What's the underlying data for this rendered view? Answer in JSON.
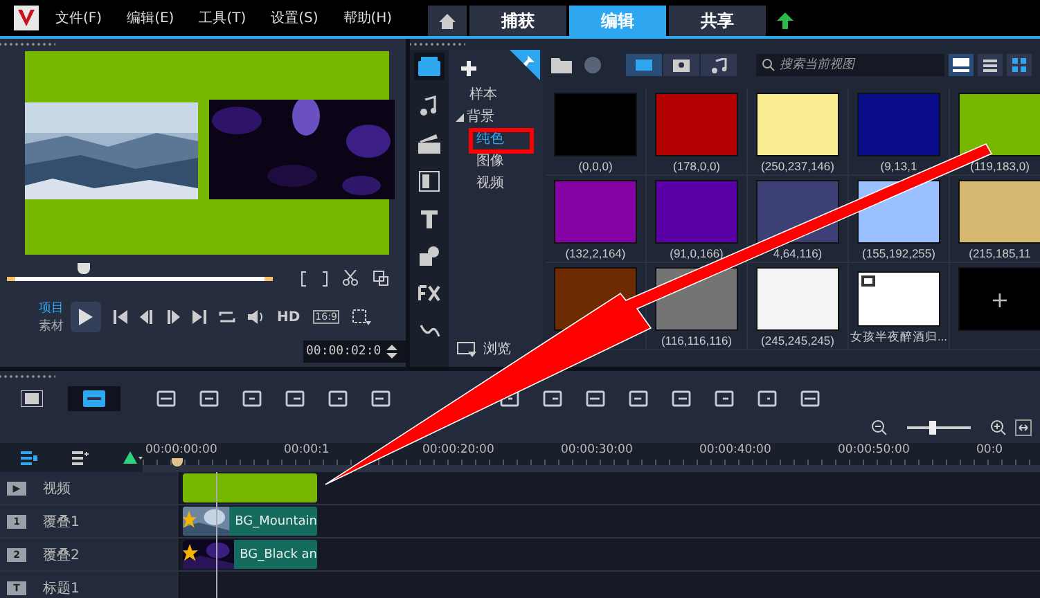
{
  "menu": [
    "文件(F)",
    "编辑(E)",
    "工具(T)",
    "设置(S)",
    "帮助(H)"
  ],
  "tabs": [
    {
      "label": "捕获",
      "selected": false
    },
    {
      "label": "编辑",
      "selected": true
    },
    {
      "label": "共享",
      "selected": false
    }
  ],
  "preview": {
    "mode_project": "项目",
    "mode_clip": "素材",
    "hd": "HD",
    "aspect": "16:9",
    "timecode": "00:00:02:0",
    "scrub": {
      "level": 0.27
    }
  },
  "library": {
    "tree": [
      {
        "label": "样本",
        "selected": false
      },
      {
        "label": "背景",
        "expanded": true,
        "children": [
          {
            "label": "纯色",
            "selected": true
          },
          {
            "label": "图像",
            "selected": false
          },
          {
            "label": "视频",
            "selected": false
          }
        ]
      }
    ],
    "browse": "浏览",
    "search": {
      "placeholder": "搜索当前视图"
    },
    "tiles": [
      {
        "kind": "color",
        "color": "#000000",
        "label": "(0,0,0)"
      },
      {
        "kind": "color",
        "color": "#b20000",
        "label": "(178,0,0)"
      },
      {
        "kind": "color",
        "color": "#faed92",
        "label": "(250,237,146)"
      },
      {
        "kind": "color",
        "color": "#090d8a",
        "label": "(9,13,1"
      },
      {
        "kind": "color",
        "color": "#77b700",
        "label": "(119,183,0)"
      },
      {
        "kind": "color",
        "color": "#8402a4",
        "label": "(132,2,164)"
      },
      {
        "kind": "color",
        "color": "#5b00a6",
        "label": "(91,0,166)"
      },
      {
        "kind": "color",
        "color": "#3c4074",
        "label": "4,64,116)"
      },
      {
        "kind": "color",
        "color": "#9bc0ff",
        "label": "(155,192,255)"
      },
      {
        "kind": "color",
        "color": "#d7b973",
        "label": "(215,185,11"
      },
      {
        "kind": "color",
        "color": "#6e2a00"
      },
      {
        "kind": "color",
        "color": "#747474",
        "label": "(116,116,116)"
      },
      {
        "kind": "color",
        "color": "#f5f5f5",
        "label": "(245,245,245)"
      },
      {
        "kind": "video",
        "color": "#ffffff",
        "label": "女孩半夜醉酒归..."
      },
      {
        "kind": "add",
        "color": "#000000",
        "label": "+"
      }
    ]
  },
  "timeline": {
    "zoom": {
      "level": 0.4
    },
    "ruler": [
      "00:00:00:00",
      "00:00:1",
      "00:00:20:00",
      "00:00:30:00",
      "00:00:40:00",
      "00:00:50:00",
      "00:0"
    ],
    "tracks": [
      {
        "name": "视频",
        "badge": "▶",
        "clip": {
          "kind": "color"
        }
      },
      {
        "name": "覆叠1",
        "badge": "1",
        "clip": {
          "label": "BG_Mountain"
        }
      },
      {
        "name": "覆叠2",
        "badge": "2",
        "clip": {
          "kind": "dark",
          "label": "BG_Black an"
        }
      },
      {
        "name": "标题1",
        "badge": "T"
      }
    ]
  }
}
